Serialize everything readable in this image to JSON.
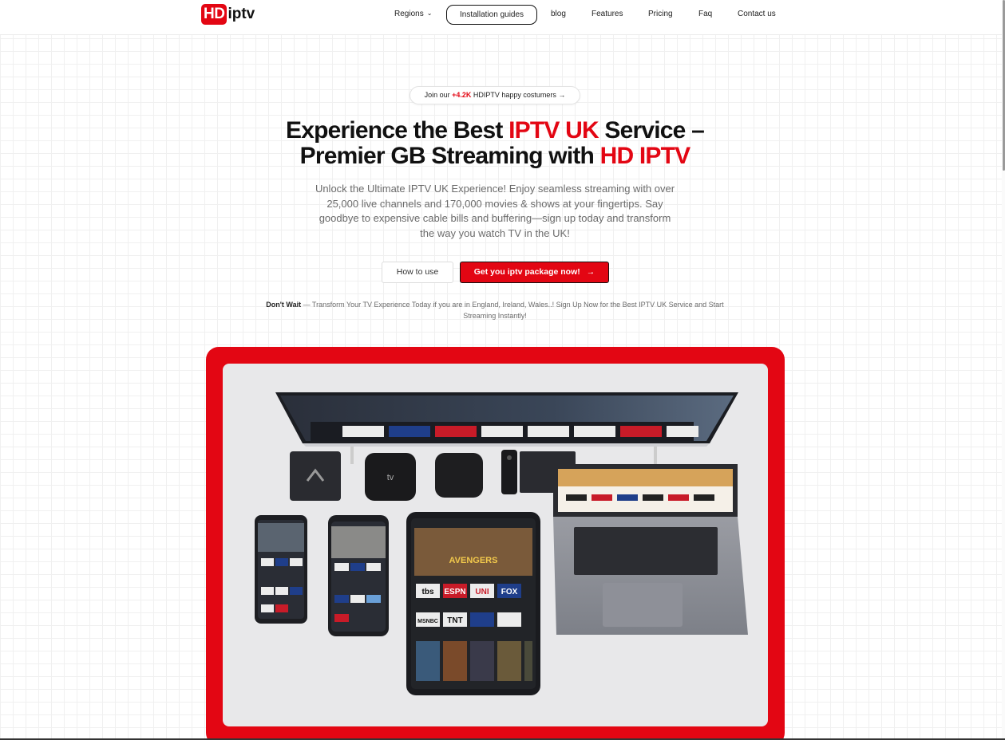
{
  "header": {
    "logo": {
      "hd": "HD",
      "rest": "iptv"
    },
    "nav": [
      {
        "label": "Regions",
        "has_dropdown": true
      },
      {
        "label": "Installation guides",
        "outlined": true
      },
      {
        "label": "blog"
      },
      {
        "label": "Features"
      },
      {
        "label": "Pricing"
      },
      {
        "label": "Faq"
      },
      {
        "label": "Contact us"
      }
    ]
  },
  "badge": {
    "prefix": "Join our ",
    "highlight": "+4.2K",
    "suffix": " HDIPTV happy costumers →"
  },
  "hero": {
    "line1_a": "Experience the Best ",
    "line1_red": "IPTV UK",
    "line1_b": " Service –",
    "line2_a": "Premier GB Streaming with ",
    "line2_red": "HD IPTV",
    "subtitle": "Unlock the Ultimate IPTV UK Experience! Enjoy seamless streaming with over 25,000 live channels and 170,000 movies & shows at your fingertips. Say goodbye to expensive cable bills and buffering—sign up today and transform the way you watch TV in the UK!"
  },
  "buttons": {
    "how_to_use": "How to use",
    "get_package": "Get you iptv package now!",
    "get_package_arrow": "→"
  },
  "note": {
    "bold": "Don't Wait",
    "text": " — Transform Your TV Experience Today if you are in England, Ireland, Wales..! Sign Up Now for the Best IPTV UK Service and Start Streaming Instantly!"
  },
  "showcase": {
    "channel_logos": [
      "tbs",
      "FOX",
      "ESPN",
      "UNI",
      "TNT",
      "MSNBC"
    ],
    "movie_title": "AVENGERS"
  },
  "colors": {
    "brand_red": "#e30613",
    "text_dark": "#111111",
    "text_muted": "#6b6b6b"
  }
}
